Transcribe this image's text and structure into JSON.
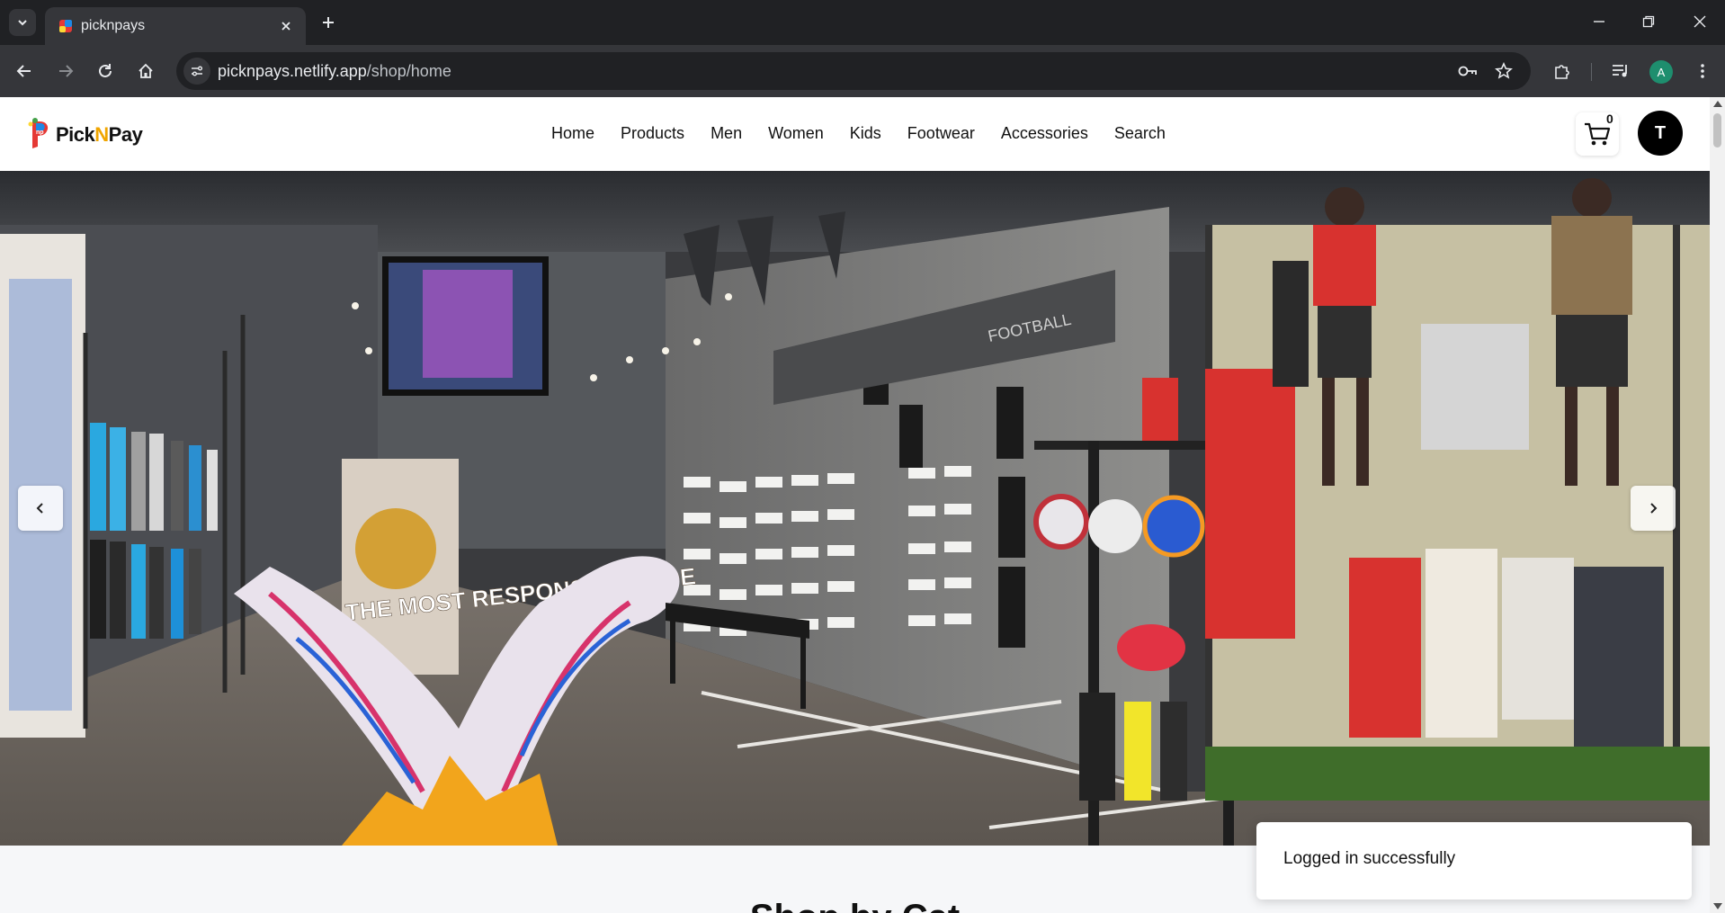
{
  "browser": {
    "tab_title": "picknpays",
    "url_host": "picknpays.netlify.app",
    "url_path": "/shop/home",
    "profile_initial": "A"
  },
  "site": {
    "logo": {
      "text_pick": "Pick",
      "text_n": "N",
      "text_pay": "Pay"
    },
    "nav": [
      {
        "label": "Home"
      },
      {
        "label": "Products"
      },
      {
        "label": "Men"
      },
      {
        "label": "Women"
      },
      {
        "label": "Kids"
      },
      {
        "label": "Footwear"
      },
      {
        "label": "Accessories"
      },
      {
        "label": "Search"
      }
    ],
    "cart_count": "0",
    "user_initial": "T"
  },
  "hero": {
    "banner_caption": "THE MOST RESPONSIVE SHOE",
    "wall_sign": "FOOTBALL"
  },
  "section": {
    "title": "Shop by Cat"
  },
  "toast": {
    "message": "Logged in successfully"
  },
  "colors": {
    "brand_accent": "#f0a500",
    "header_bg": "#ffffff",
    "chrome_dark": "#202124"
  }
}
